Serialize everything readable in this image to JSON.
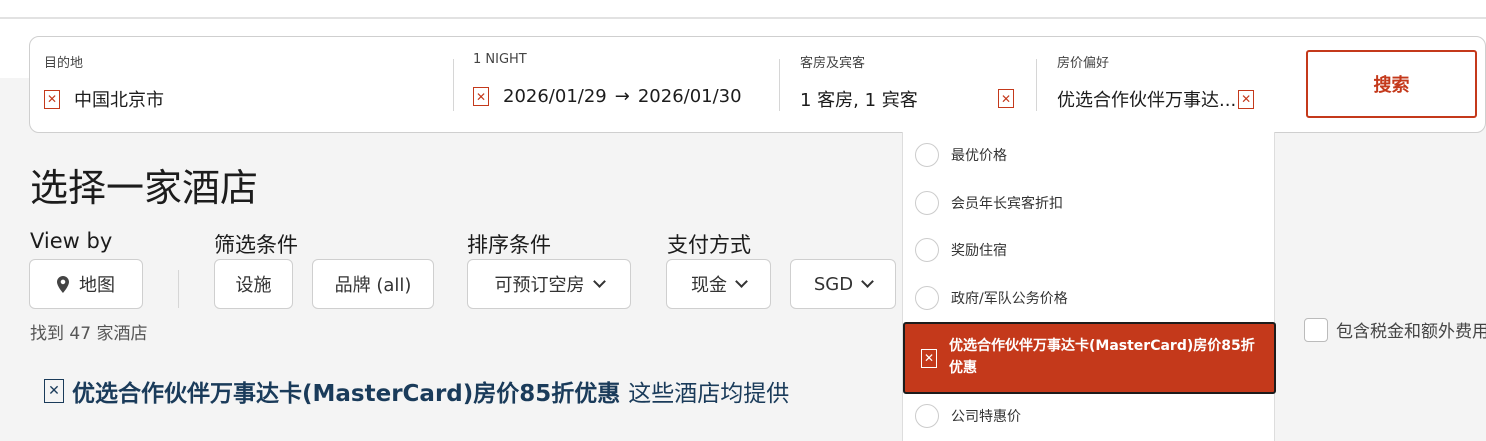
{
  "search": {
    "destination": {
      "label": "目的地",
      "value": "中国北京市"
    },
    "dates": {
      "label": "1 NIGHT",
      "checkin": "2026/01/29",
      "arrow": "→",
      "checkout": "2026/01/30"
    },
    "rooms": {
      "label": "客房及宾客",
      "value": "1 客房, 1 宾客"
    },
    "rate": {
      "label": "房价偏好",
      "value": "优选合作伙伴万事达..."
    },
    "button": "搜索"
  },
  "page": {
    "title": "选择一家酒店",
    "result_count": "找到 47 家酒店"
  },
  "filters": {
    "view_by": {
      "label": "View by",
      "map": "地图"
    },
    "filter": {
      "label": "筛选条件",
      "amenities": "设施",
      "brand": "品牌 (all)"
    },
    "sort": {
      "label": "排序条件",
      "value": "可预订空房"
    },
    "payment": {
      "label": "支付方式",
      "method": "现金",
      "currency": "SGD"
    }
  },
  "promo": {
    "strong": "优选合作伙伴万事达卡(MasterCard)房价85折优惠",
    "rest": "这些酒店均提供"
  },
  "rate_options": [
    {
      "label": "最优价格",
      "selected": false
    },
    {
      "label": "会员年长宾客折扣",
      "selected": false
    },
    {
      "label": "奖励住宿",
      "selected": false
    },
    {
      "label": "政府/军队公务价格",
      "selected": false
    },
    {
      "label": "优选合作伙伴万事达卡(MasterCard)房价85折优惠",
      "selected": true
    },
    {
      "label": "公司特惠价",
      "selected": false
    }
  ],
  "tax_checkbox": {
    "label": "包含税金和额外费用"
  },
  "icons": {
    "location": "map-pin-icon",
    "placeholder": "missing-glyph-icon",
    "chevron": "chevron-down-icon"
  },
  "colors": {
    "accent": "#c4391b",
    "promo_text": "#1a3b5a",
    "background": "#f4f4f4"
  }
}
